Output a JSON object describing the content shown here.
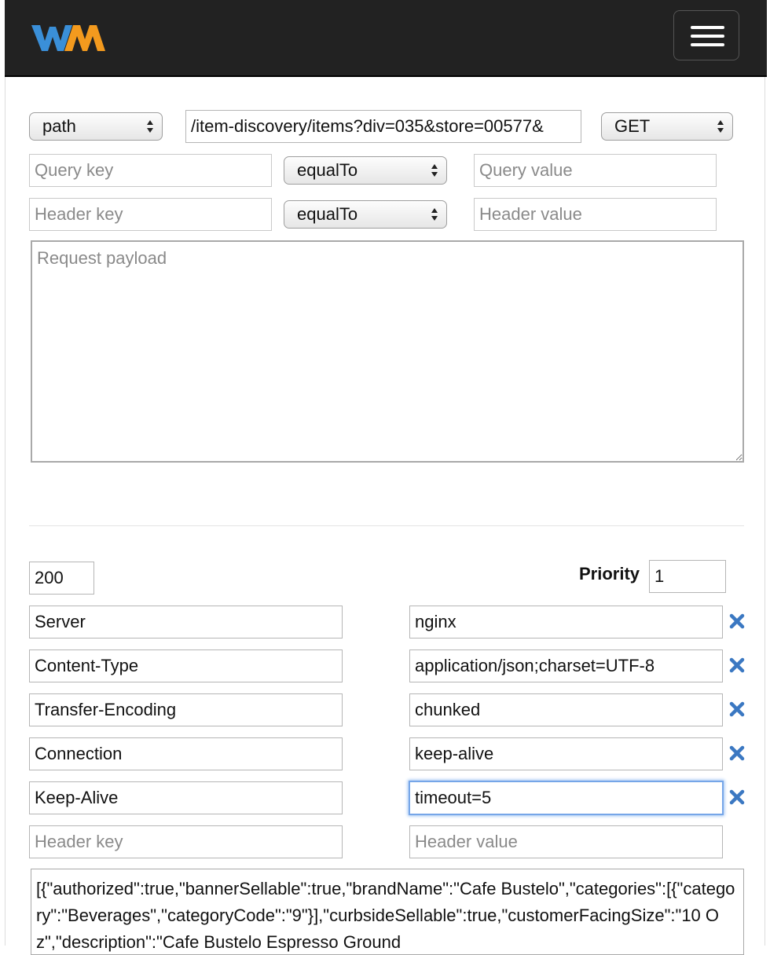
{
  "request": {
    "match_type": "path",
    "path_value": "/item-discovery/items?div=035&store=00577&",
    "method": "GET",
    "query": {
      "key_placeholder": "Query key",
      "operator": "equalTo",
      "value_placeholder": "Query value"
    },
    "header": {
      "key_placeholder": "Header key",
      "operator": "equalTo",
      "value_placeholder": "Header value"
    },
    "payload_placeholder": "Request payload"
  },
  "response": {
    "status_code": "200",
    "priority_label": "Priority",
    "priority_value": "1",
    "headers": [
      {
        "key": "Server",
        "value": "nginx"
      },
      {
        "key": "Content-Type",
        "value": "application/json;charset=UTF-8"
      },
      {
        "key": "Transfer-Encoding",
        "value": "chunked"
      },
      {
        "key": "Connection",
        "value": "keep-alive"
      },
      {
        "key": "Keep-Alive",
        "value": "timeout=5"
      }
    ],
    "new_header": {
      "key_placeholder": "Header key",
      "value_placeholder": "Header value"
    },
    "body": "[{\"authorized\":true,\"bannerSellable\":true,\"brandName\":\"Cafe Bustelo\",\"categories\":[{\"category\":\"Beverages\",\"categoryCode\":\"9\"}],\"curbsideSellable\":true,\"customerFacingSize\":\"10 Oz\",\"description\":\"Cafe Bustelo Espresso Ground"
  },
  "colors": {
    "navbar": "#222222",
    "logo_blue": "#3a8fd8",
    "logo_orange": "#f39a1e",
    "remove_icon": "#3b78c2",
    "focus_ring": "#76a6e8"
  }
}
